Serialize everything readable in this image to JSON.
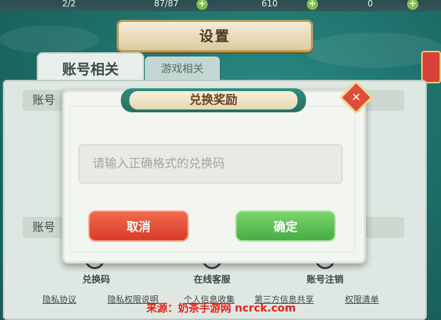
{
  "top_stats": {
    "stat1": "2/2",
    "stat2": "87/87",
    "stat3": "610",
    "stat4": "0"
  },
  "screen_title": "设置",
  "tabs": [
    {
      "label": "账号相关",
      "active": true
    },
    {
      "label": "游戏相关",
      "active": false
    }
  ],
  "sections": {
    "section1_label": "账号",
    "section2_label": "账号"
  },
  "bottom_actions": [
    {
      "label": "兑换码",
      "icon": "gift-icon"
    },
    {
      "label": "在线客服",
      "icon": "headset-icon"
    },
    {
      "label": "账号注销",
      "icon": "logout-icon"
    }
  ],
  "links": [
    "隐私协议",
    "隐私权限说明",
    "个人信息收集",
    "第三方信息共享",
    "权限清单"
  ],
  "dialog": {
    "title": "兑换奖励",
    "input_placeholder": "请输入正确格式的兑换码",
    "cancel_label": "取消",
    "confirm_label": "确定",
    "close_icon": "close-icon"
  },
  "watermark": "来源：奶茶手游网 ncrck.com",
  "colors": {
    "cancel": "#e04c36",
    "confirm": "#5cbd55",
    "dialog_banner": "#2a7e71",
    "background": "#1d6e6a"
  }
}
